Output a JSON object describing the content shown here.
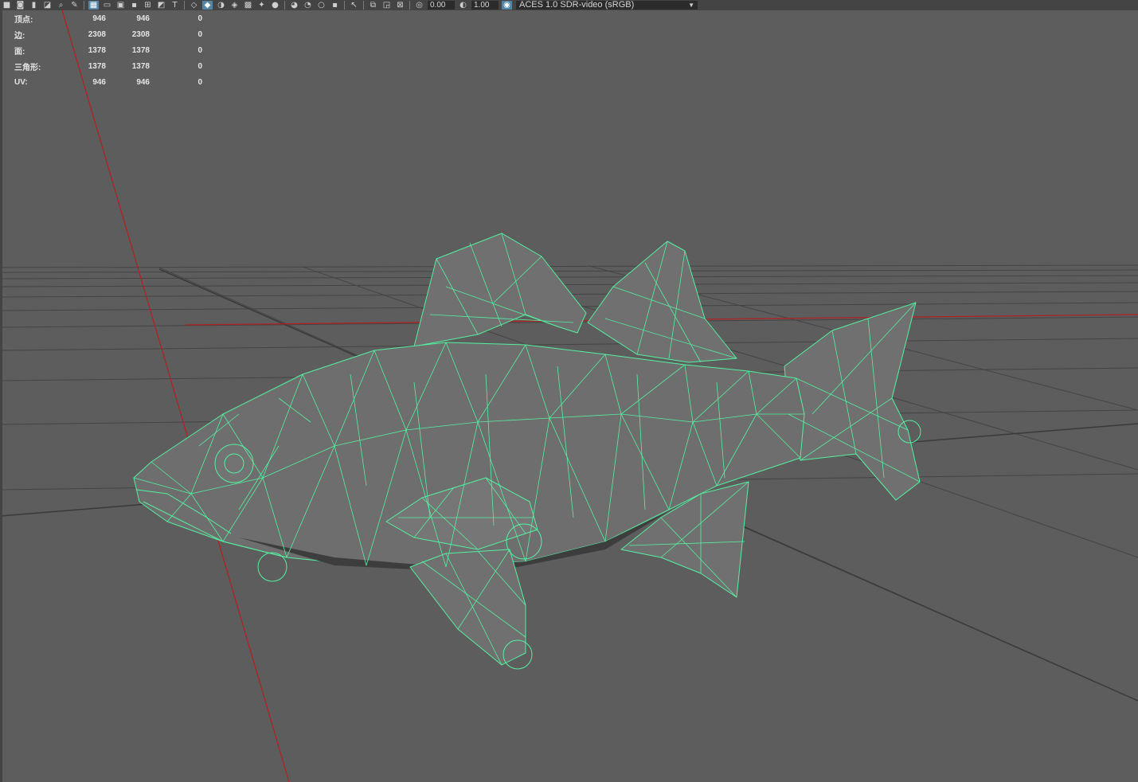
{
  "toolbar": {
    "icons": [
      "camera-icon",
      "camera-attributes-icon",
      "bookmark-icon",
      "image-plane-icon",
      "grid-icon",
      "film-gate-icon",
      "resolution-gate-icon",
      "gate-mask-icon",
      "field-chart-icon",
      "safe-action-icon",
      "safe-title-icon",
      "wireframe-icon",
      "smooth-shade-icon",
      "default-lighting-icon",
      "textured-icon",
      "use-all-lights-icon",
      "shadows-icon",
      "ambient-occlusion-icon",
      "motion-blur-icon",
      "anti-aliasing-icon",
      "depth-of-field-icon",
      "isolate-select-icon",
      "xray-icon",
      "xray-joints-icon",
      "xray-active-icon",
      "backface-culling-icon",
      "exposure-icon",
      "gamma-icon",
      "color-management-icon"
    ],
    "exposure_value": "0.00",
    "gamma_value": "1.00",
    "color_space": "ACES 1.0 SDR-video (sRGB)"
  },
  "hud": {
    "rows": [
      {
        "label": "顶点:",
        "v1": "946",
        "v2": "946",
        "v3": "0"
      },
      {
        "label": "边:",
        "v1": "2308",
        "v2": "2308",
        "v3": "0"
      },
      {
        "label": "面:",
        "v1": "1378",
        "v2": "1378",
        "v3": "0"
      },
      {
        "label": "三角形:",
        "v1": "1378",
        "v2": "1378",
        "v3": "0"
      },
      {
        "label": "UV:",
        "v1": "946",
        "v2": "946",
        "v3": "0"
      }
    ]
  },
  "colors": {
    "viewport_bg": "#5d5d5d",
    "wireframe": "#55f0a0",
    "mesh_fill": "#707070",
    "grid": "#434343",
    "axis_red": "#b22020",
    "axis_dark": "#3a3a3a"
  }
}
